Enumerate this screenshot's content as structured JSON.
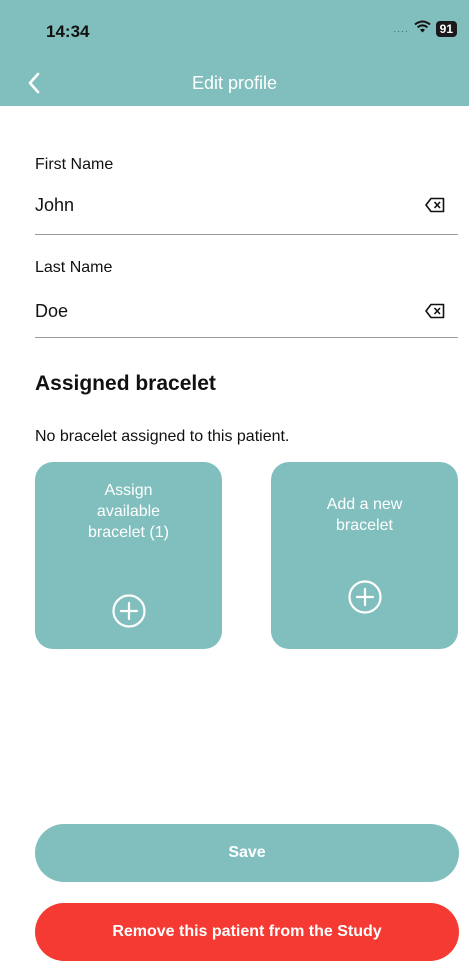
{
  "status_bar": {
    "time": "14:34",
    "signal": "....",
    "battery": "91"
  },
  "nav": {
    "title": "Edit profile"
  },
  "form": {
    "first_name": {
      "label": "First Name",
      "value": "John"
    },
    "last_name": {
      "label": "Last Name",
      "value": "Doe"
    }
  },
  "bracelet": {
    "section_title": "Assigned bracelet",
    "info": "No bracelet assigned to this patient.",
    "assign_card": {
      "line1": "Assign",
      "line2": "available",
      "line3": "bracelet (1)"
    },
    "add_card": {
      "line1": "Add a new",
      "line2": "bracelet"
    }
  },
  "actions": {
    "save_label": "Save",
    "remove_label": "Remove this patient from the Study"
  },
  "colors": {
    "accent": "#80bfbd",
    "danger": "#f53a33"
  }
}
